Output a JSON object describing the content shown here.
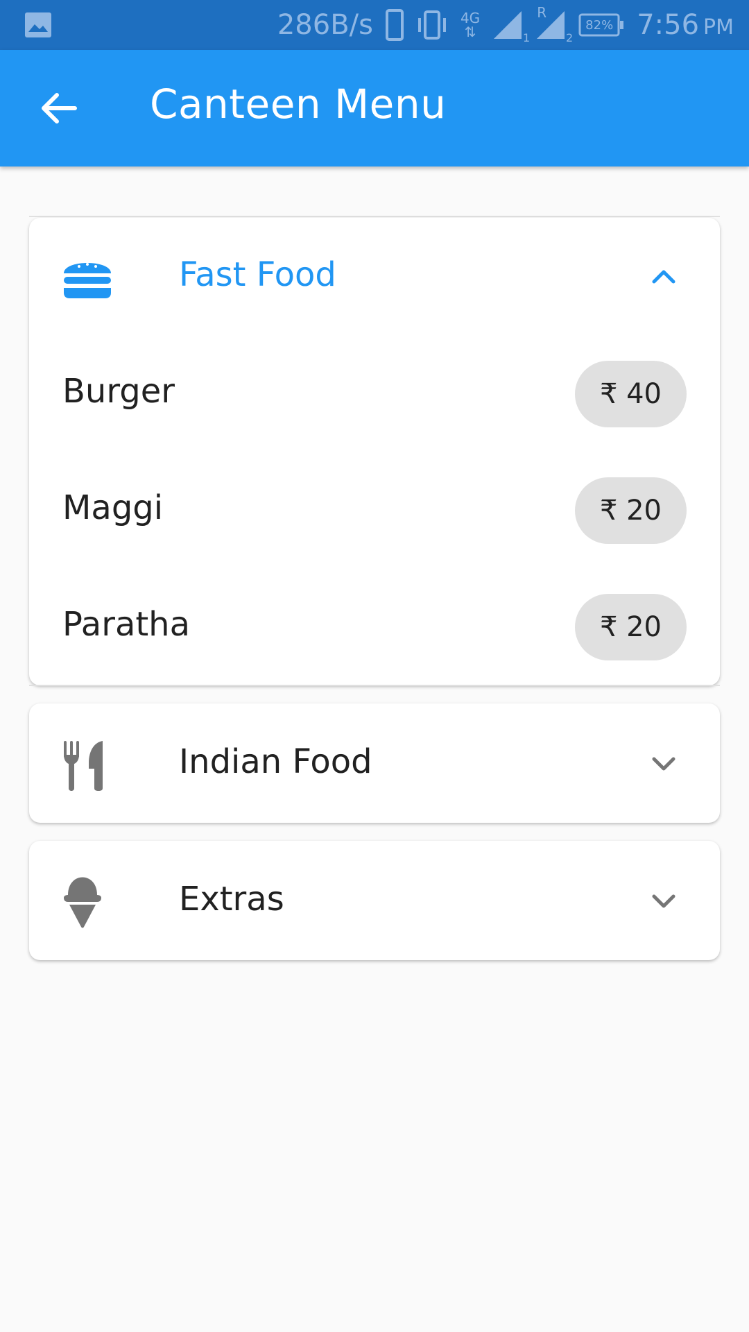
{
  "status_bar": {
    "net_speed": "286B/s",
    "network_type": "4G",
    "sim1_label": "1",
    "roaming_label": "R",
    "sim2_label": "2",
    "battery": "82%",
    "time": "7:56",
    "ampm": "PM",
    "icons": [
      "image-icon",
      "phone-icon",
      "vibrate-icon",
      "4g-icon",
      "signal-icon",
      "signal-roaming-icon",
      "battery-icon"
    ]
  },
  "app_bar": {
    "title": "Canteen Menu",
    "back_icon": "arrow-back-icon",
    "color": "#2196f3"
  },
  "menu": {
    "sections": [
      {
        "label": "Fast Food",
        "icon": "hamburger-icon",
        "expanded": true,
        "items": [
          {
            "name": "Burger",
            "price": "₹ 40"
          },
          {
            "name": "Maggi",
            "price": "₹ 20"
          },
          {
            "name": "Paratha",
            "price": "₹ 20"
          }
        ]
      },
      {
        "label": "Indian Food",
        "icon": "restaurant-icon",
        "expanded": false
      },
      {
        "label": "Extras",
        "icon": "ice-cream-icon",
        "expanded": false
      }
    ]
  },
  "colors": {
    "accent": "#2196f3",
    "status_bar": "#1e6fc0",
    "chip_bg": "#e0e0e0",
    "icon_grey": "#757575"
  }
}
